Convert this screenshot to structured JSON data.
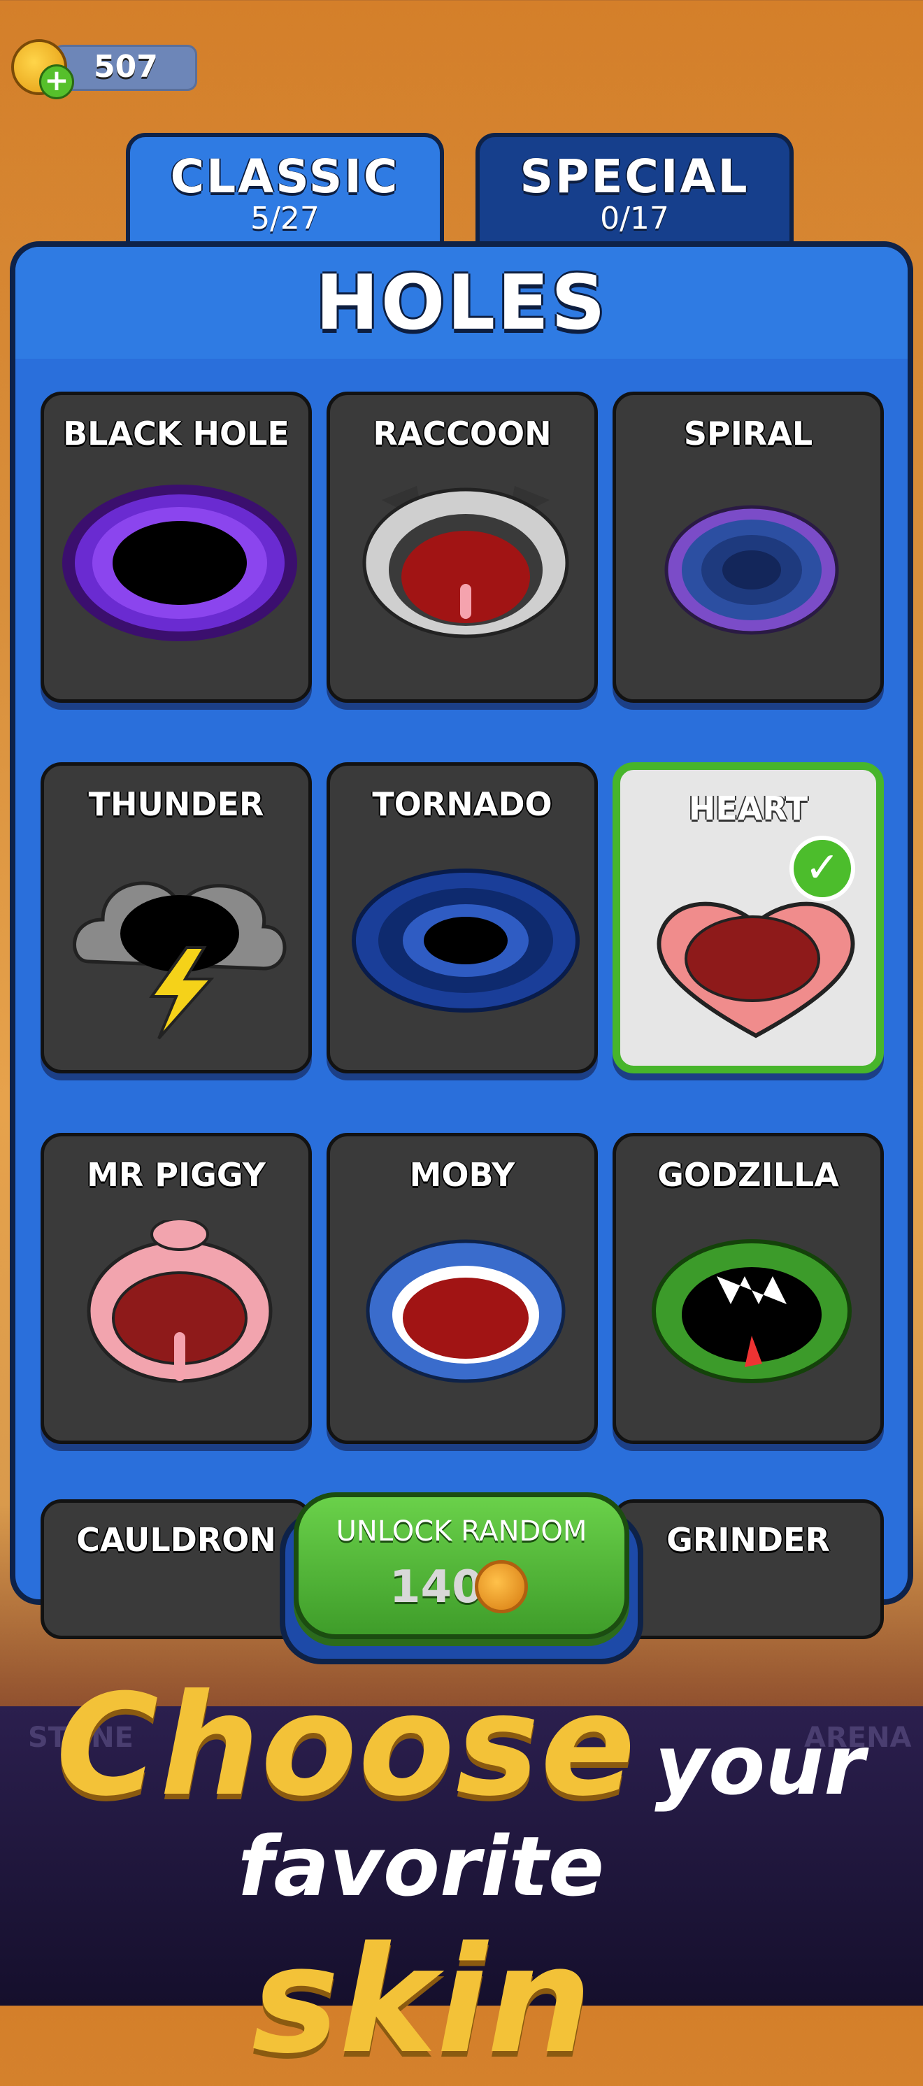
{
  "currency": {
    "coins": "507",
    "icon": "coin-icon",
    "add_icon": "plus-icon"
  },
  "tabs": [
    {
      "title": "CLASSIC",
      "count": "5/27",
      "active": true
    },
    {
      "title": "SPECIAL",
      "count": "0/17",
      "active": false
    }
  ],
  "panel": {
    "title": "HOLES"
  },
  "skins": [
    {
      "label": "BLACK HOLE"
    },
    {
      "label": "RACCOON"
    },
    {
      "label": "SPIRAL"
    },
    {
      "label": "THUNDER"
    },
    {
      "label": "TORNADO"
    },
    {
      "label": "HEART",
      "selected": true
    },
    {
      "label": "MR PIGGY"
    },
    {
      "label": "MOBY"
    },
    {
      "label": "GODZILLA"
    }
  ],
  "bottom_row": [
    {
      "label": "CAULDRON"
    },
    {
      "label": "GRINDER"
    }
  ],
  "unlock": {
    "title": "UNLOCK RANDOM",
    "price": "140"
  },
  "promo": {
    "word1": "Choose",
    "word2": "your",
    "word3": "favorite",
    "word4": "skin"
  },
  "background_labels": {
    "left": "STONE",
    "right": "ARENA"
  },
  "colors": {
    "accent_green": "#47b52b",
    "panel_blue": "#2a6fdb",
    "gold": "#f3c238"
  }
}
